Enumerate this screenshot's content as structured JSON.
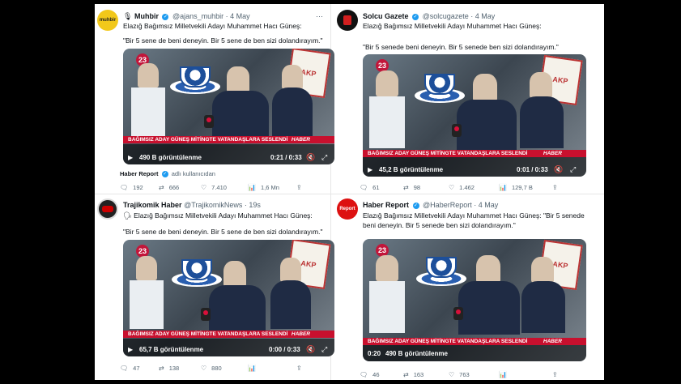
{
  "tweets": [
    {
      "name": "Muhbir",
      "handle": "@ajans_muhbir",
      "date": "4 May",
      "avatar_text": "muhbir",
      "text1": "Elazığ Bağımsız Milletvekili Adayı Muhammet Hacı Güneş:",
      "text2": "\"Bir 5 sene de beni deneyin. Bir 5 sene de ben sizi dolandırayım.\"",
      "video": {
        "channel": "23",
        "banner": "BAĞIMSIZ ADAY GÜNEŞ MİTİNGTE VATANDAŞLARA SESLENDİ",
        "haber": "HABER",
        "views": "490 B görüntülenme",
        "time": "0:21 / 0:33"
      },
      "source_name": "Haber Report",
      "source_suffix": "adlı kullanıcıdan",
      "counts": {
        "replies": "192",
        "retweets": "666",
        "likes": "7.410",
        "views": "1,6 Mn"
      }
    },
    {
      "name": "Solcu Gazete",
      "handle": "@solcugazete",
      "date": "4 May",
      "avatar_text": "",
      "text1": "Elazığ Bağımsız Milletvekili Adayı Muhammet Hacı Güneş:",
      "text2": "\"Bir 5 senede beni deneyin. Bir 5 senede ben sizi dolandırayım.\"",
      "video": {
        "channel": "23",
        "banner": "BAĞIMSIZ ADAY GÜNEŞ MİTİNGTE VATANDAŞLARA SESLENDİ",
        "haber": "HABER",
        "views": "45,2 B görüntülenme",
        "time": "0:01 / 0:33"
      },
      "counts": {
        "replies": "61",
        "retweets": "98",
        "likes": "1.462",
        "views": "129,7 B"
      }
    },
    {
      "name": "Trajikomik Haber",
      "handle": "@TrajikomikNews",
      "date": "19s",
      "avatar_text": "",
      "text1": "Elazığ Bağımsız Milletvekili Adayı Muhammet Hacı Güneş:",
      "text2": "\"Bir 5 sene de beni deneyin. Bir 5 sene de ben sizi dolandırayım.\"",
      "video": {
        "channel": "23",
        "banner": "BAĞIMSIZ ADAY GÜNEŞ MİTİNGTE VATANDAŞLARA SESLENDİ",
        "haber": "HABER",
        "views": "65,7 B görüntülenme",
        "time": "0:00 / 0:33"
      },
      "counts": {
        "replies": "47",
        "retweets": "138",
        "likes": "880",
        "views": ""
      }
    },
    {
      "name": "Haber Report",
      "handle": "@HaberReport",
      "date": "4 May",
      "avatar_text": "Report",
      "text1": "Elazığ Bağımsız Milletvekili Adayı Muhammet Hacı Güneş: \"Bir 5 senede",
      "text2": "beni deneyin. Bir 5 senede ben sizi dolandırayım.\"",
      "video": {
        "channel": "23",
        "banner": "BAĞIMSIZ ADAY GÜNEŞ MİTİNGTE VATANDAŞLARA SESLENDİ",
        "haber": "HABER",
        "views": "490 B görüntülenme",
        "time": "0:20"
      },
      "counts": {
        "replies": "46",
        "retweets": "163",
        "likes": "763",
        "views": ""
      }
    }
  ],
  "colors": {
    "verified": "#1d9bf0",
    "banner_red": "#c8102e"
  },
  "icons": {
    "reply": "reply-icon",
    "retweet": "retweet-icon",
    "like": "heart-icon",
    "views": "views-icon",
    "share": "share-icon"
  }
}
